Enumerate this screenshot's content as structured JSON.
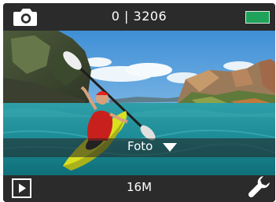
{
  "status": {
    "counter": "0 | 3206",
    "mode_icon": "camera-icon",
    "battery_icon": "battery-full-icon",
    "battery_color": "#1fa35a"
  },
  "mode": {
    "label": "Foto",
    "dropdown_icon": "triangle-down-icon"
  },
  "resolution": "16M",
  "controls": {
    "playback_icon": "play-icon",
    "settings_icon": "wrench-icon"
  }
}
